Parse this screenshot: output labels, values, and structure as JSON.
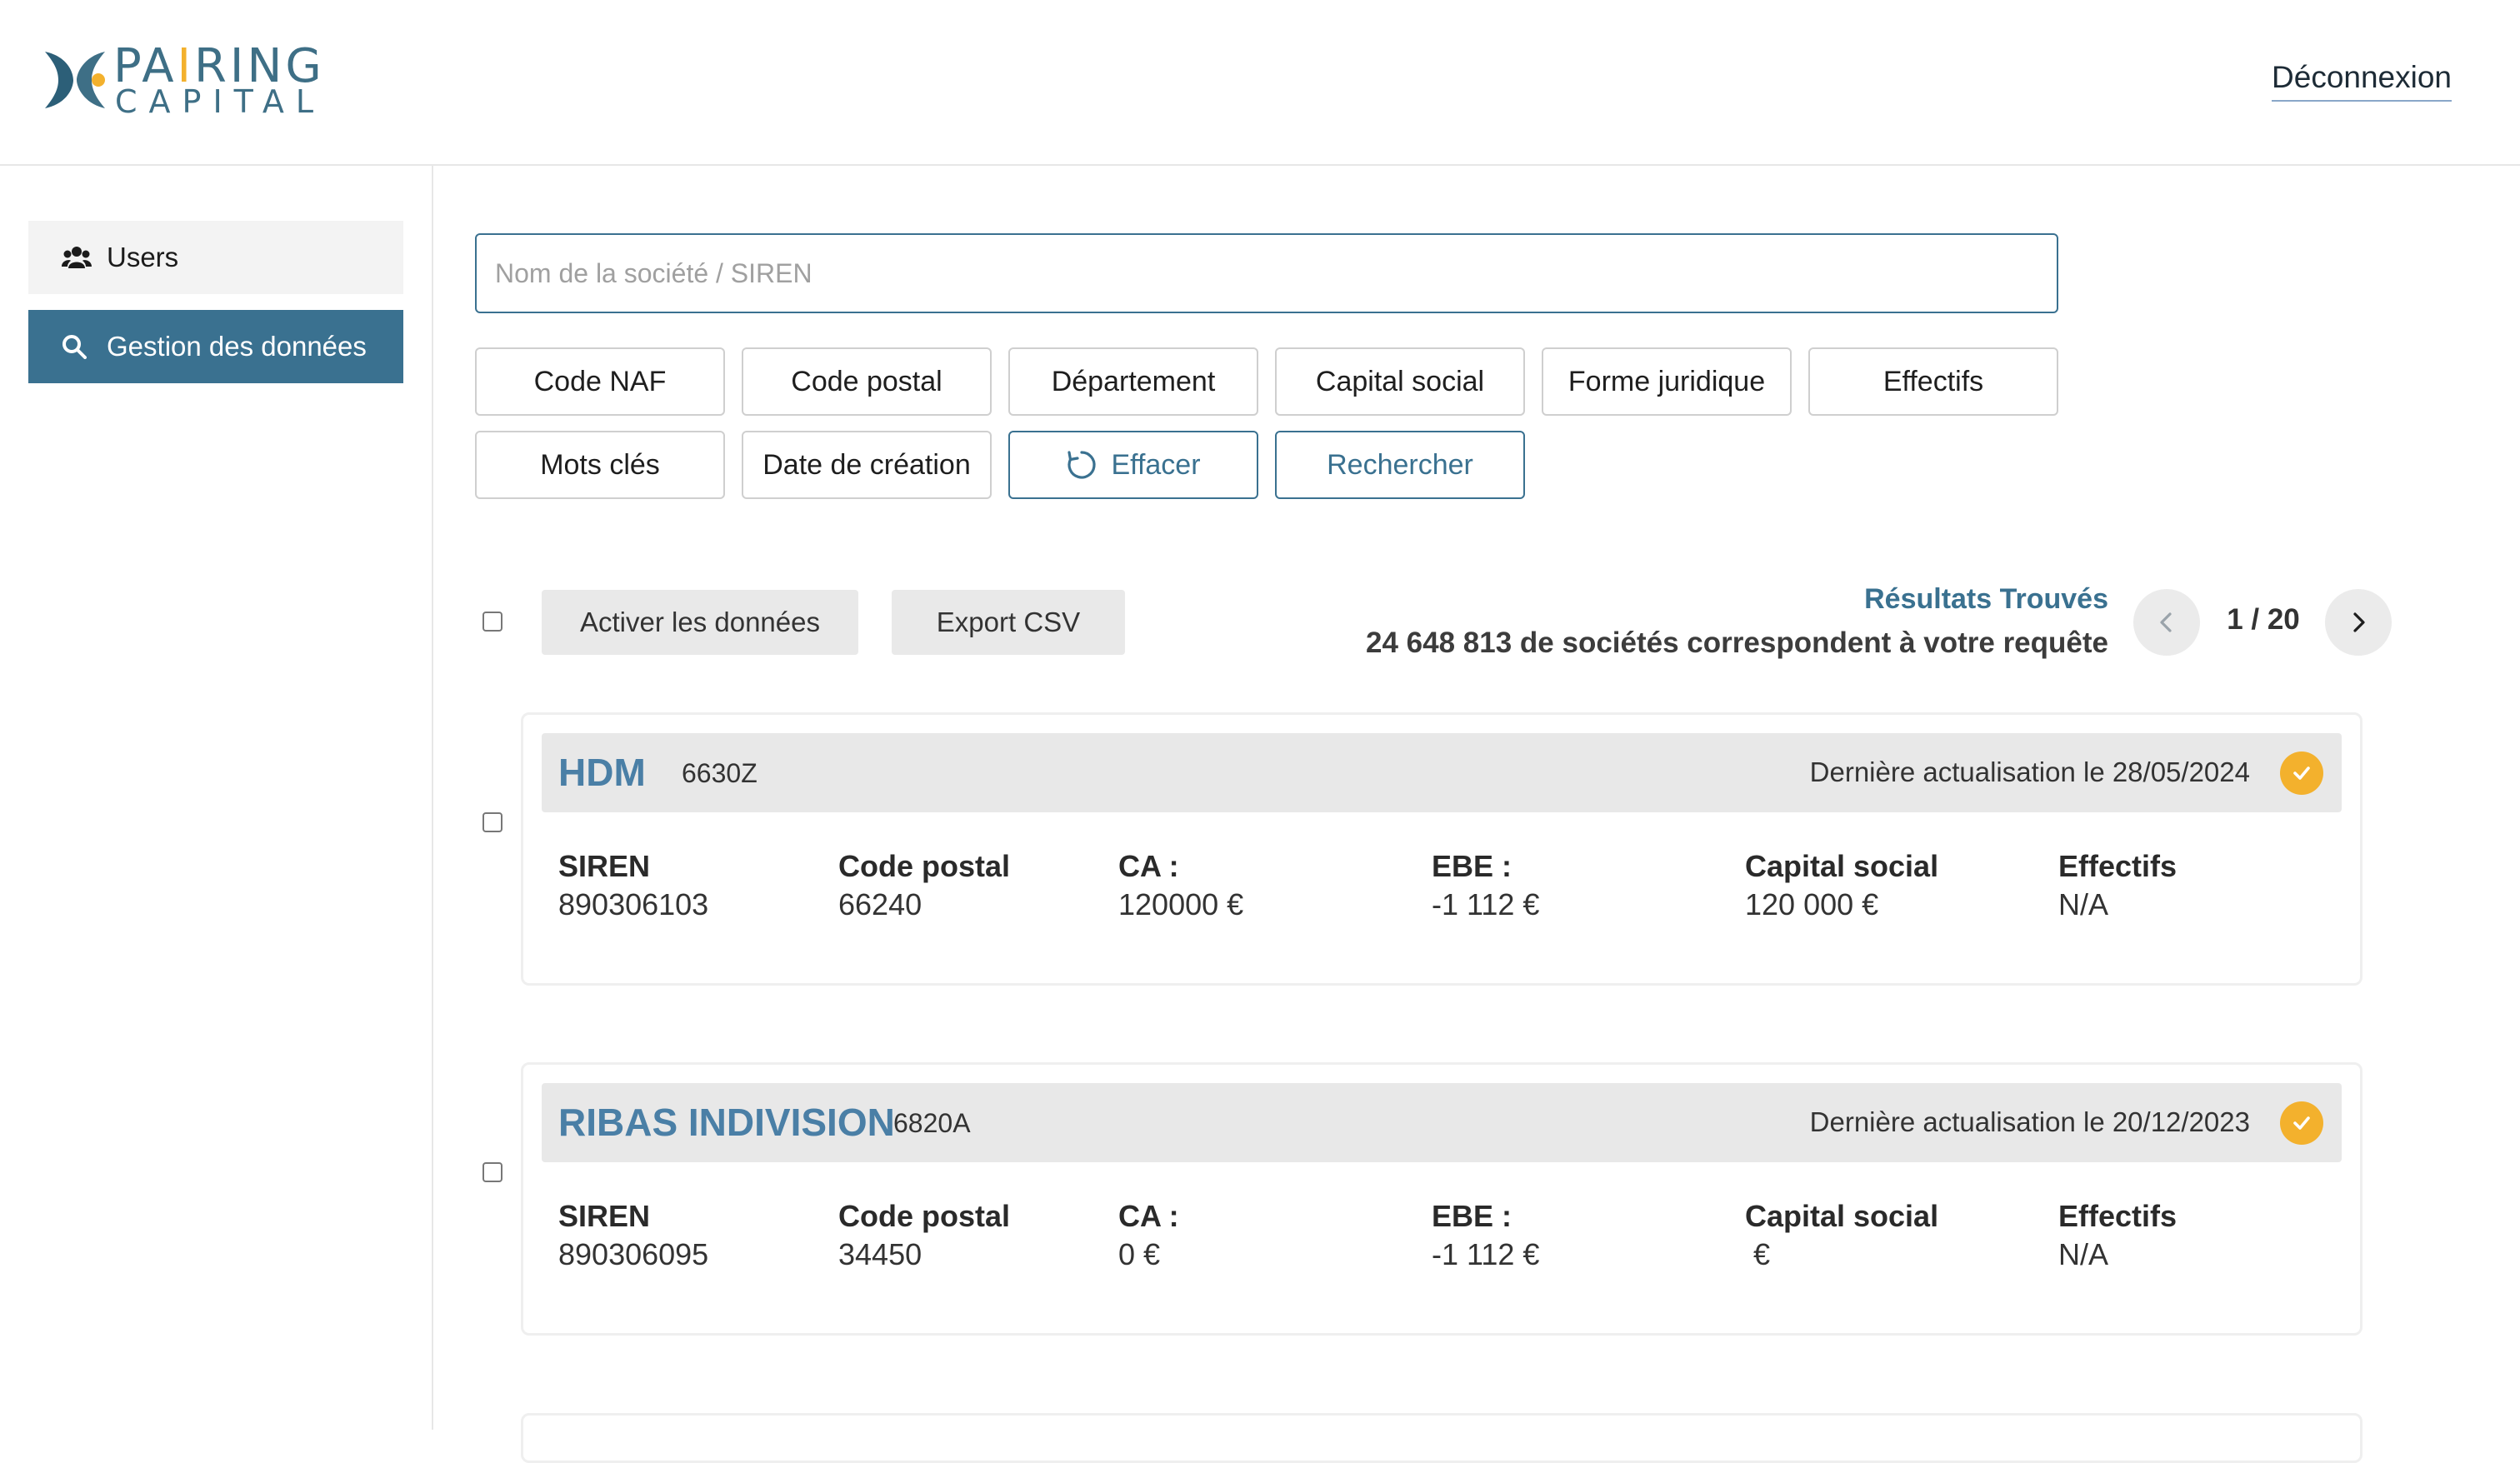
{
  "header": {
    "logo_line1_part1": "PA",
    "logo_line1_accent": "I",
    "logo_line1_part2": "RING",
    "logo_line2": "CAPITAL",
    "logout_label": "Déconnexion"
  },
  "sidebar": {
    "items": [
      {
        "label": "Users",
        "icon": "users-icon"
      },
      {
        "label": "Gestion des données",
        "icon": "search-icon"
      }
    ]
  },
  "search": {
    "placeholder": "Nom de la société / SIREN",
    "value": ""
  },
  "filters": [
    "Code NAF",
    "Code postal",
    "Département",
    "Capital social",
    "Forme juridique",
    "Effectifs",
    "Mots clés",
    "Date de création"
  ],
  "actions": {
    "clear_label": "Effacer",
    "search_label": "Rechercher"
  },
  "toolbar": {
    "activate_label": "Activer les données",
    "export_label": "Export CSV",
    "results_title": "Résultats Trouvés",
    "results_count": "24 648 813 de sociétés correspondent à votre requête",
    "pagination": "1 / 20"
  },
  "companies": [
    {
      "name": "HDM",
      "naf": "6630Z",
      "updated": "Dernière actualisation le 28/05/2024",
      "fields": [
        {
          "label": "SIREN",
          "value": "890306103"
        },
        {
          "label": "Code postal",
          "value": "66240"
        },
        {
          "label": "CA :",
          "value": "120000 €"
        },
        {
          "label": "EBE :",
          "value": "-1 112 €"
        },
        {
          "label": "Capital social",
          "value": "120 000 €"
        },
        {
          "label": "Effectifs",
          "value": "N/A"
        }
      ]
    },
    {
      "name": "RIBAS INDIVISION",
      "naf": "6820A",
      "updated": "Dernière actualisation le 20/12/2023",
      "fields": [
        {
          "label": "SIREN",
          "value": "890306095"
        },
        {
          "label": "Code postal",
          "value": "34450"
        },
        {
          "label": "CA :",
          "value": "0 €"
        },
        {
          "label": "EBE :",
          "value": "-1 112 €"
        },
        {
          "label": "Capital social",
          "value": " €"
        },
        {
          "label": "Effectifs",
          "value": "N/A"
        }
      ]
    }
  ],
  "colors": {
    "primary": "#3a7190",
    "accent": "#f3b12d",
    "company_link": "#4a7fa6"
  }
}
